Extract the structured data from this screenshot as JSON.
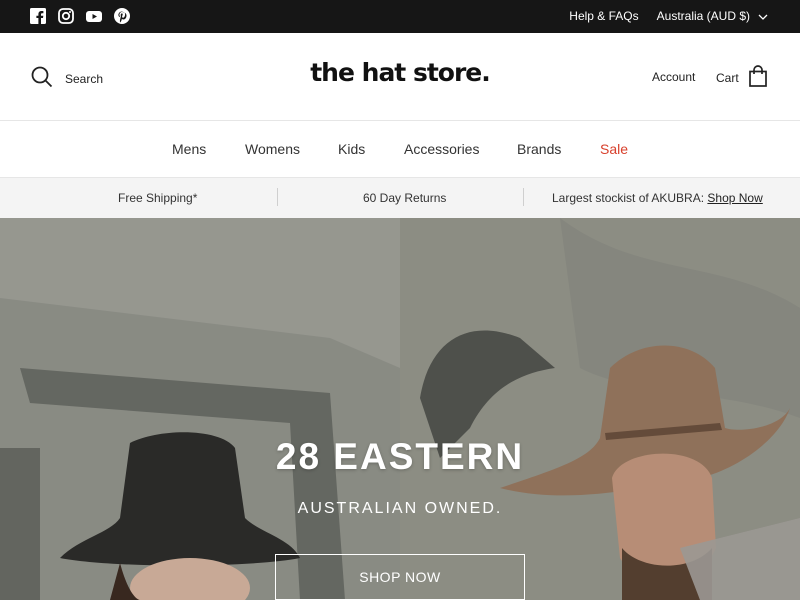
{
  "topbar": {
    "social": [
      "facebook-icon",
      "instagram-icon",
      "youtube-icon",
      "pinterest-icon"
    ],
    "help_label": "Help & FAQs",
    "locale_label": "Australia (AUD $)"
  },
  "header": {
    "search_label": "Search",
    "logo_text": "the hat store.",
    "account_label": "Account",
    "cart_label": "Cart"
  },
  "nav": {
    "items": [
      {
        "label": "Mens"
      },
      {
        "label": "Womens"
      },
      {
        "label": "Kids"
      },
      {
        "label": "Accessories"
      },
      {
        "label": "Brands"
      },
      {
        "label": "Sale"
      }
    ],
    "sale_color": "#d8402c"
  },
  "strip": {
    "shipping": "Free Shipping*",
    "returns": "60 Day Returns",
    "stockist": "Largest stockist of AKUBRA:",
    "shop_now_link": "Shop Now"
  },
  "hero": {
    "title": "28 EASTERN",
    "subtitle": "AUSTRALIAN OWNED.",
    "button_label": "SHOP NOW"
  }
}
